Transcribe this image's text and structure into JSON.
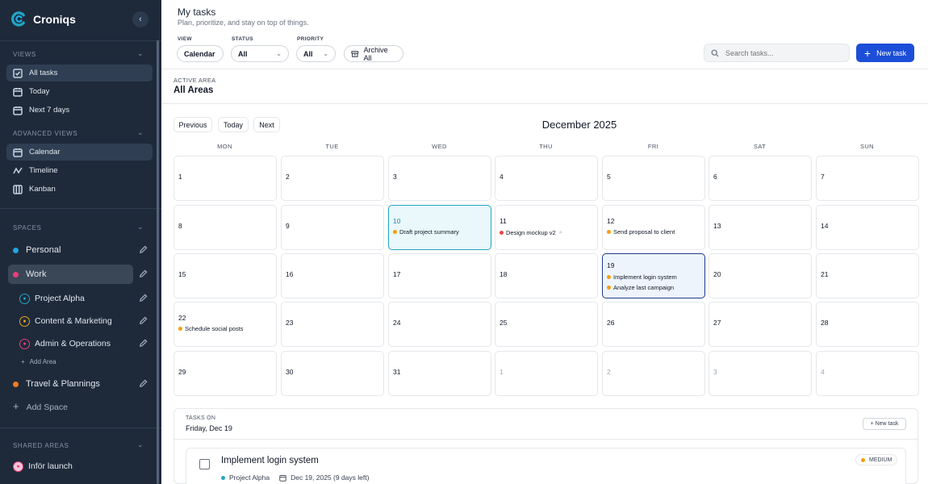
{
  "app": {
    "name": "Croniqs",
    "brand_color": "#22a5c4"
  },
  "sidebar": {
    "views_label": "VIEWS",
    "views": [
      {
        "label": "All tasks",
        "icon": "checkbox-icon",
        "active": true
      },
      {
        "label": "Today",
        "icon": "calendar-icon"
      },
      {
        "label": "Next 7 days",
        "icon": "calendar-icon"
      }
    ],
    "advanced_label": "ADVANCED VIEWS",
    "advanced": [
      {
        "label": "Calendar",
        "icon": "calendar-icon",
        "active": true
      },
      {
        "label": "Timeline",
        "icon": "timeline-icon"
      },
      {
        "label": "Kanban",
        "icon": "kanban-icon"
      }
    ],
    "spaces_label": "SPACES",
    "spaces": [
      {
        "label": "Personal",
        "color": "#1ea7e0"
      },
      {
        "label": "Work",
        "color": "#e93f7a",
        "active": true
      },
      {
        "label": "Travel & Plannings",
        "color": "#f47b20"
      }
    ],
    "areas": [
      {
        "label": "Project Alpha",
        "color": "#22a5c4"
      },
      {
        "label": "Content & Marketing",
        "color": "#e9a21f"
      },
      {
        "label": "Admin & Operations",
        "color": "#e93f7a"
      }
    ],
    "add_area": "Add Area",
    "add_space": "Add Space",
    "shared_label": "SHARED AREAS",
    "shared": [
      {
        "label": "Inför launch",
        "color": "#e93f7a"
      }
    ]
  },
  "header": {
    "title": "My tasks",
    "subtitle": "Plan, prioritize, and stay on top of things.",
    "view_label": "VIEW",
    "view_value": "Calendar",
    "status_label": "STATUS",
    "status_value": "All",
    "priority_label": "PRIORITY",
    "priority_value": "All",
    "archive_label": "Archive All",
    "search_placeholder": "Search tasks...",
    "new_task_label": "New task"
  },
  "area": {
    "label": "ACTIVE AREA",
    "value": "All Areas"
  },
  "calendar": {
    "prev": "Previous",
    "today": "Today",
    "next": "Next",
    "month": "December 2025",
    "weekdays": [
      "MON",
      "TUE",
      "WED",
      "THU",
      "FRI",
      "SAT",
      "SUN"
    ],
    "weeks": [
      [
        {
          "n": "1"
        },
        {
          "n": "2"
        },
        {
          "n": "3"
        },
        {
          "n": "4"
        },
        {
          "n": "5"
        },
        {
          "n": "6"
        },
        {
          "n": "7"
        }
      ],
      [
        {
          "n": "8"
        },
        {
          "n": "9"
        },
        {
          "n": "10",
          "highlight": "today",
          "events": [
            {
              "t": "Draft project summary",
              "c": "#f59e0b"
            }
          ]
        },
        {
          "n": "11",
          "events": [
            {
              "t": "Design mockup v2",
              "c": "#ef4444",
              "clip": true
            }
          ]
        },
        {
          "n": "12",
          "events": [
            {
              "t": "Send proposal to client",
              "c": "#f59e0b"
            }
          ]
        },
        {
          "n": "13"
        },
        {
          "n": "14"
        }
      ],
      [
        {
          "n": "15"
        },
        {
          "n": "16"
        },
        {
          "n": "17"
        },
        {
          "n": "18"
        },
        {
          "n": "19",
          "highlight": "selected",
          "events": [
            {
              "t": "Implement login system",
              "c": "#f59e0b"
            },
            {
              "t": "Analyze last campaign",
              "c": "#f59e0b"
            }
          ]
        },
        {
          "n": "20"
        },
        {
          "n": "21"
        }
      ],
      [
        {
          "n": "22",
          "events": [
            {
              "t": "Schedule social posts",
              "c": "#f59e0b"
            }
          ]
        },
        {
          "n": "23"
        },
        {
          "n": "24"
        },
        {
          "n": "25"
        },
        {
          "n": "26"
        },
        {
          "n": "27"
        },
        {
          "n": "28"
        }
      ],
      [
        {
          "n": "29"
        },
        {
          "n": "30"
        },
        {
          "n": "31"
        },
        {
          "n": "1",
          "other": true
        },
        {
          "n": "2",
          "other": true
        },
        {
          "n": "3",
          "other": true
        },
        {
          "n": "4",
          "other": true
        }
      ]
    ]
  },
  "tasks_panel": {
    "label": "TASKS ON",
    "date": "Friday, Dec 19",
    "new_task": "+ New task",
    "task": {
      "title": "Implement login system",
      "area": "Project Alpha",
      "area_color": "#22a5c4",
      "due": "Dec 19, 2025 (9 days left)",
      "priority": "MEDIUM",
      "priority_color": "#f59e0b"
    }
  }
}
